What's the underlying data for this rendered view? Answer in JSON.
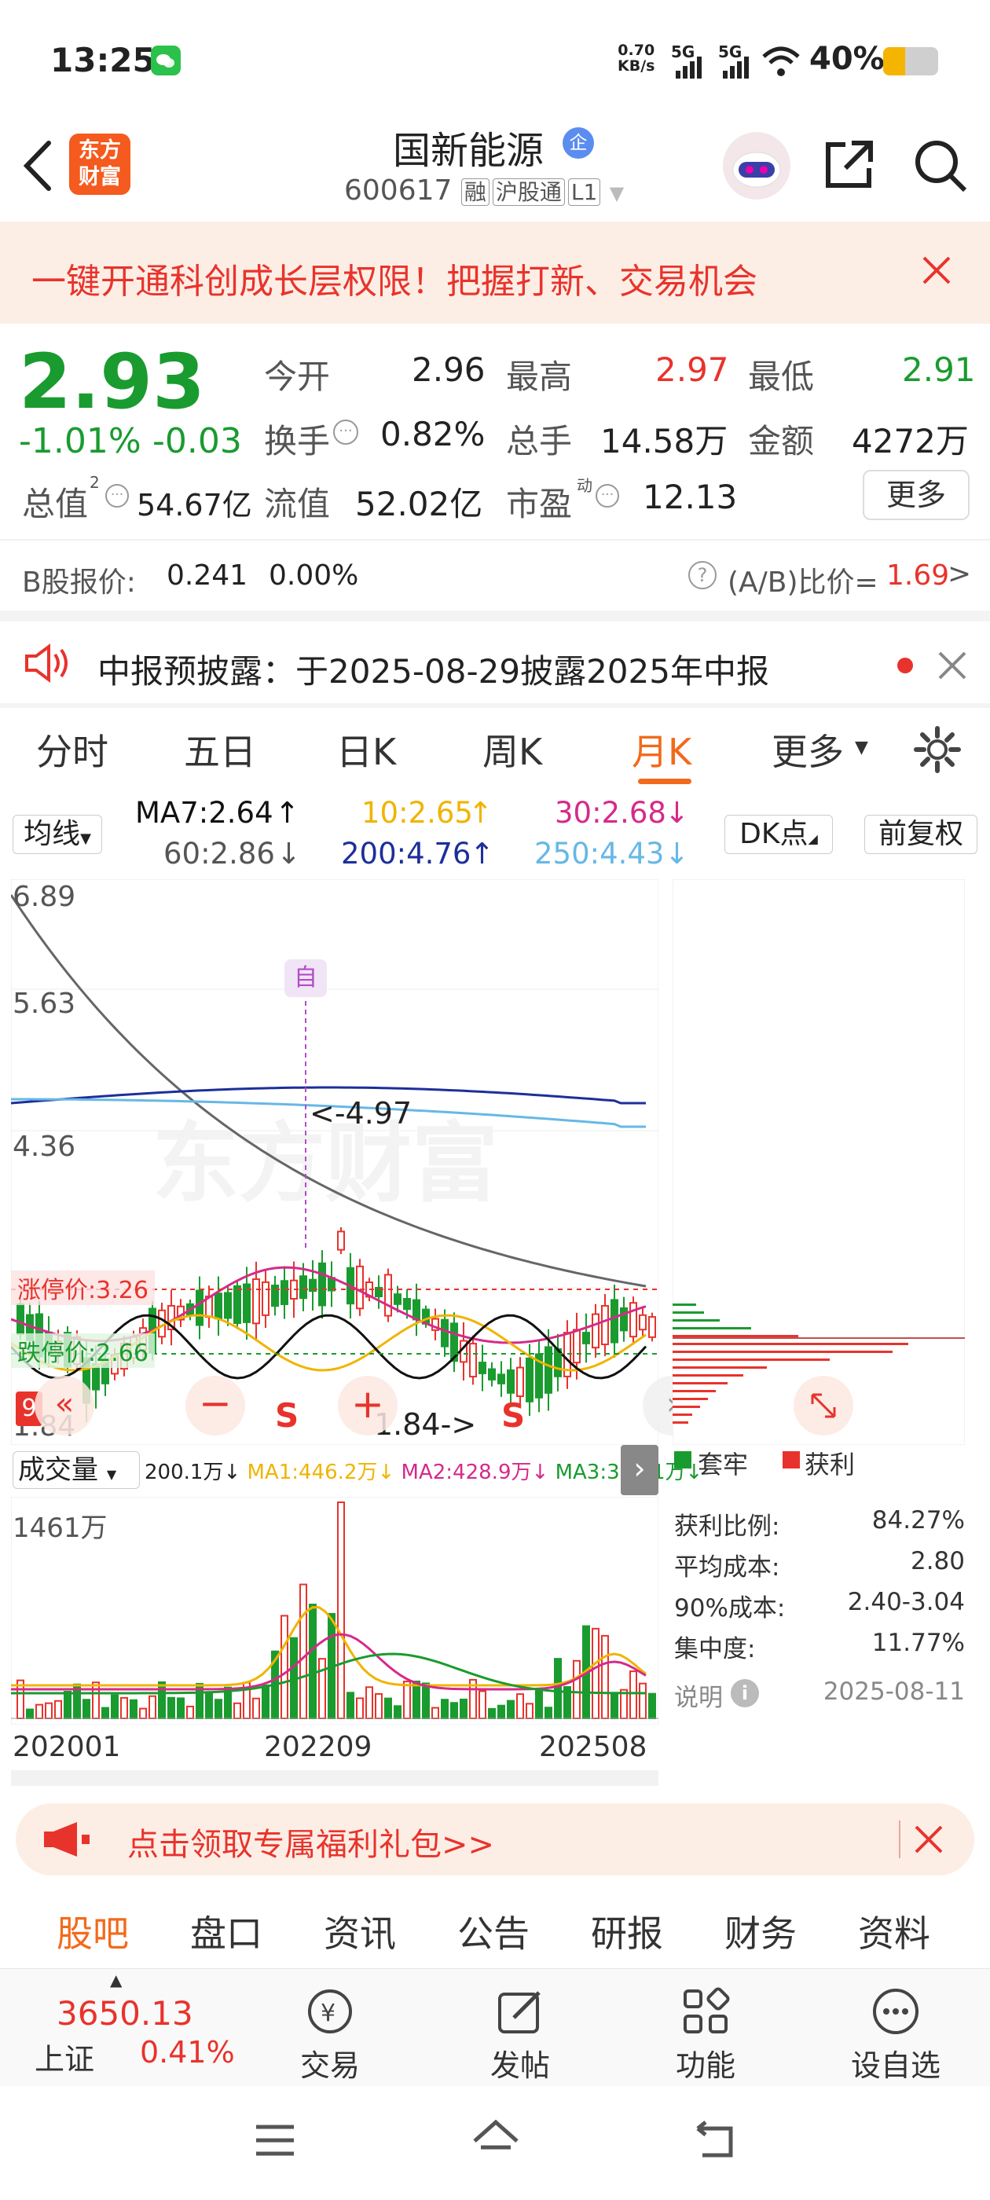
{
  "status_bar": {
    "time": "13:25",
    "net_speed_value": "0.70",
    "net_speed_unit": "KB/s",
    "sig1": "5G",
    "sig2": "5G",
    "battery": "40%"
  },
  "header": {
    "logo_line1": "东方",
    "logo_line2": "财富",
    "stock_name": "国新能源",
    "badge": "企",
    "code": "600617",
    "tag1": "融",
    "tag2": "沪股通",
    "tag3": "L1"
  },
  "banner": {
    "text": "一键开通科创成长层权限！把握打新、交易机会"
  },
  "quote": {
    "price": "2.93",
    "change_pct": "-1.01%",
    "change": "-0.03",
    "open_label": "今开",
    "open": "2.96",
    "high_label": "最高",
    "high": "2.97",
    "low_label": "最低",
    "low": "2.91",
    "turnover_label": "换手",
    "turnover": "0.82%",
    "volume_label": "总手",
    "volume": "14.58万",
    "amount_label": "金额",
    "amount": "4272万",
    "mktcap_label": "总值",
    "mktcap_sup": "2",
    "mktcap": "54.67亿",
    "float_label": "流值",
    "float": "52.02亿",
    "pe_label": "市盈",
    "pe_sup": "动",
    "pe": "12.13",
    "more": "更多",
    "b_label": "B股报价:",
    "b_price": "0.241",
    "b_pct": "0.00%",
    "ab_label": "(A/B)比价=",
    "ab_value": "1.69"
  },
  "notice": {
    "text": "中报预披露：于2025-08-29披露2025年中报"
  },
  "tabs": [
    "分时",
    "五日",
    "日K",
    "周K",
    "月K",
    "更多"
  ],
  "active_tab": "月K",
  "ma_bar": {
    "select": "均线",
    "ma7": "MA7:2.64",
    "ma10": "10:2.65",
    "ma30": "30:2.68",
    "ma60": "60:2.86",
    "ma200": "200:4.76",
    "ma250": "250:4.43",
    "dk": "DK点",
    "fq": "前复权"
  },
  "kline": {
    "y_labels": [
      "6.89",
      "5.63",
      "4.36",
      "1.84"
    ],
    "self_marker": "自",
    "max_label": "<-4.97",
    "min_label": "1.84->",
    "limit_up": "涨停价:3.26",
    "limit_down": "跌停价:2.66",
    "s1": "S",
    "s2": "S",
    "corner_num": "9",
    "colors": {
      "up": "#e8332c",
      "down": "#1a9b2f",
      "ma7": "#111111",
      "ma10": "#f0b400",
      "ma30": "#d62a8a",
      "ma60": "#666666",
      "ma200": "#1d2f9a",
      "ma250": "#66b8e6"
    }
  },
  "volume": {
    "select": "成交量",
    "vol": "200.1万",
    "ma1": "MA1:446.2万",
    "ma2": "MA2:428.9万",
    "ma3": "MA3:364.1万",
    "max_label": "1461万",
    "x_labels": [
      "202001",
      "202209",
      "202508"
    ]
  },
  "chip": {
    "legend_a": "套牢",
    "legend_b": "获利",
    "rows": [
      {
        "label": "获利比例:",
        "value": "84.27%"
      },
      {
        "label": "平均成本:",
        "value": "2.80"
      },
      {
        "label": "90%成本:",
        "value": "2.40-3.04"
      },
      {
        "label": "集中度:",
        "value": "11.77%"
      }
    ],
    "note": "说明",
    "date": "2025-08-11"
  },
  "promo": {
    "text": "点击领取专属福利礼包>>"
  },
  "subtabs": [
    "股吧",
    "盘口",
    "资讯",
    "公告",
    "研报",
    "财务",
    "资料"
  ],
  "active_subtab": "股吧",
  "bottom_nav": {
    "index_value": "3650.13",
    "index_name": "上证",
    "index_pct": "0.41%",
    "items": [
      "交易",
      "发帖",
      "功能",
      "设自选"
    ]
  }
}
